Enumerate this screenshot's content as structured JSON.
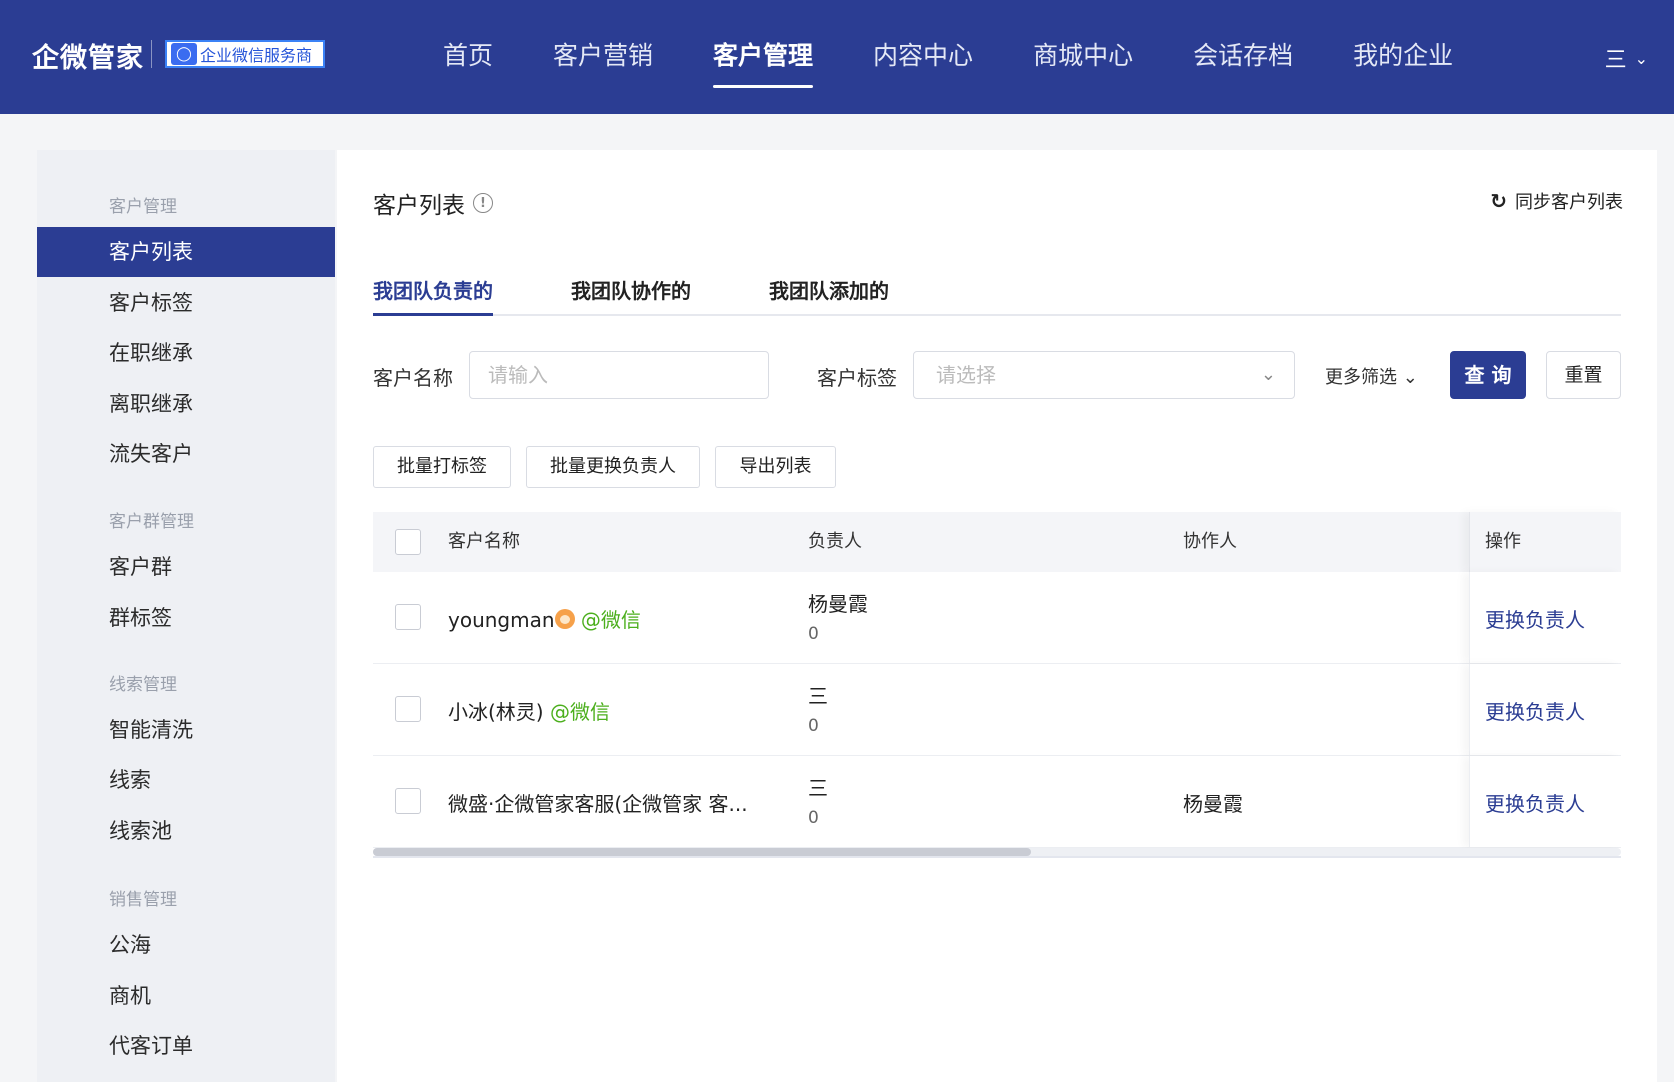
{
  "header": {
    "logo": "企微管家",
    "badge_icon": "chat-bubble-icon",
    "badge_text": "企业微信服务商",
    "nav": [
      {
        "label": "首页",
        "active": false
      },
      {
        "label": "客户营销",
        "active": false
      },
      {
        "label": "客户管理",
        "active": true
      },
      {
        "label": "内容中心",
        "active": false
      },
      {
        "label": "商城中心",
        "active": false
      },
      {
        "label": "会话存档",
        "active": false
      },
      {
        "label": "我的企业",
        "active": false
      }
    ],
    "menu_toggle": "三"
  },
  "sidebar": {
    "groups": [
      {
        "title": "客户管理",
        "items": [
          "客户列表",
          "客户标签",
          "在职继承",
          "离职继承",
          "流失客户"
        ]
      },
      {
        "title": "客户群管理",
        "items": [
          "客户群",
          "群标签"
        ]
      },
      {
        "title": "线索管理",
        "items": [
          "智能清洗",
          "线索",
          "线索池"
        ]
      },
      {
        "title": "销售管理",
        "items": [
          "公海",
          "商机",
          "代客订单"
        ]
      }
    ],
    "active_item": "客户列表"
  },
  "main": {
    "title": "客户列表",
    "sync_label": "同步客户列表",
    "tabs": [
      "我团队负责的",
      "我团队协作的",
      "我团队添加的"
    ],
    "active_tab": "我团队负责的",
    "filters": {
      "name_label": "客户名称",
      "name_placeholder": "请输入",
      "tag_label": "客户标签",
      "tag_placeholder": "请选择",
      "more_label": "更多筛选",
      "query_label": "查 询",
      "reset_label": "重置"
    },
    "batch_buttons": [
      "批量打标签",
      "批量更换负责人",
      "导出列表"
    ],
    "table": {
      "headers": [
        "客户名称",
        "负责人",
        "协作人",
        "操作"
      ],
      "rows": [
        {
          "name": "youngman",
          "source": "@微信",
          "owner": "杨曼霞",
          "owner_count": "0",
          "collaborator": "",
          "action": "更换负责人"
        },
        {
          "name": "小冰(林灵)",
          "source": "@微信",
          "owner": "三",
          "owner_count": "0",
          "collaborator": "",
          "action": "更换负责人"
        },
        {
          "name": "微盛·企微管家客服(企微管家 客...",
          "source": "",
          "owner": "三",
          "owner_count": "0",
          "collaborator": "杨曼霞",
          "action": "更换负责人"
        }
      ]
    }
  },
  "colors": {
    "brand": "#2b3d93",
    "wechat_green": "#4caf1d"
  }
}
